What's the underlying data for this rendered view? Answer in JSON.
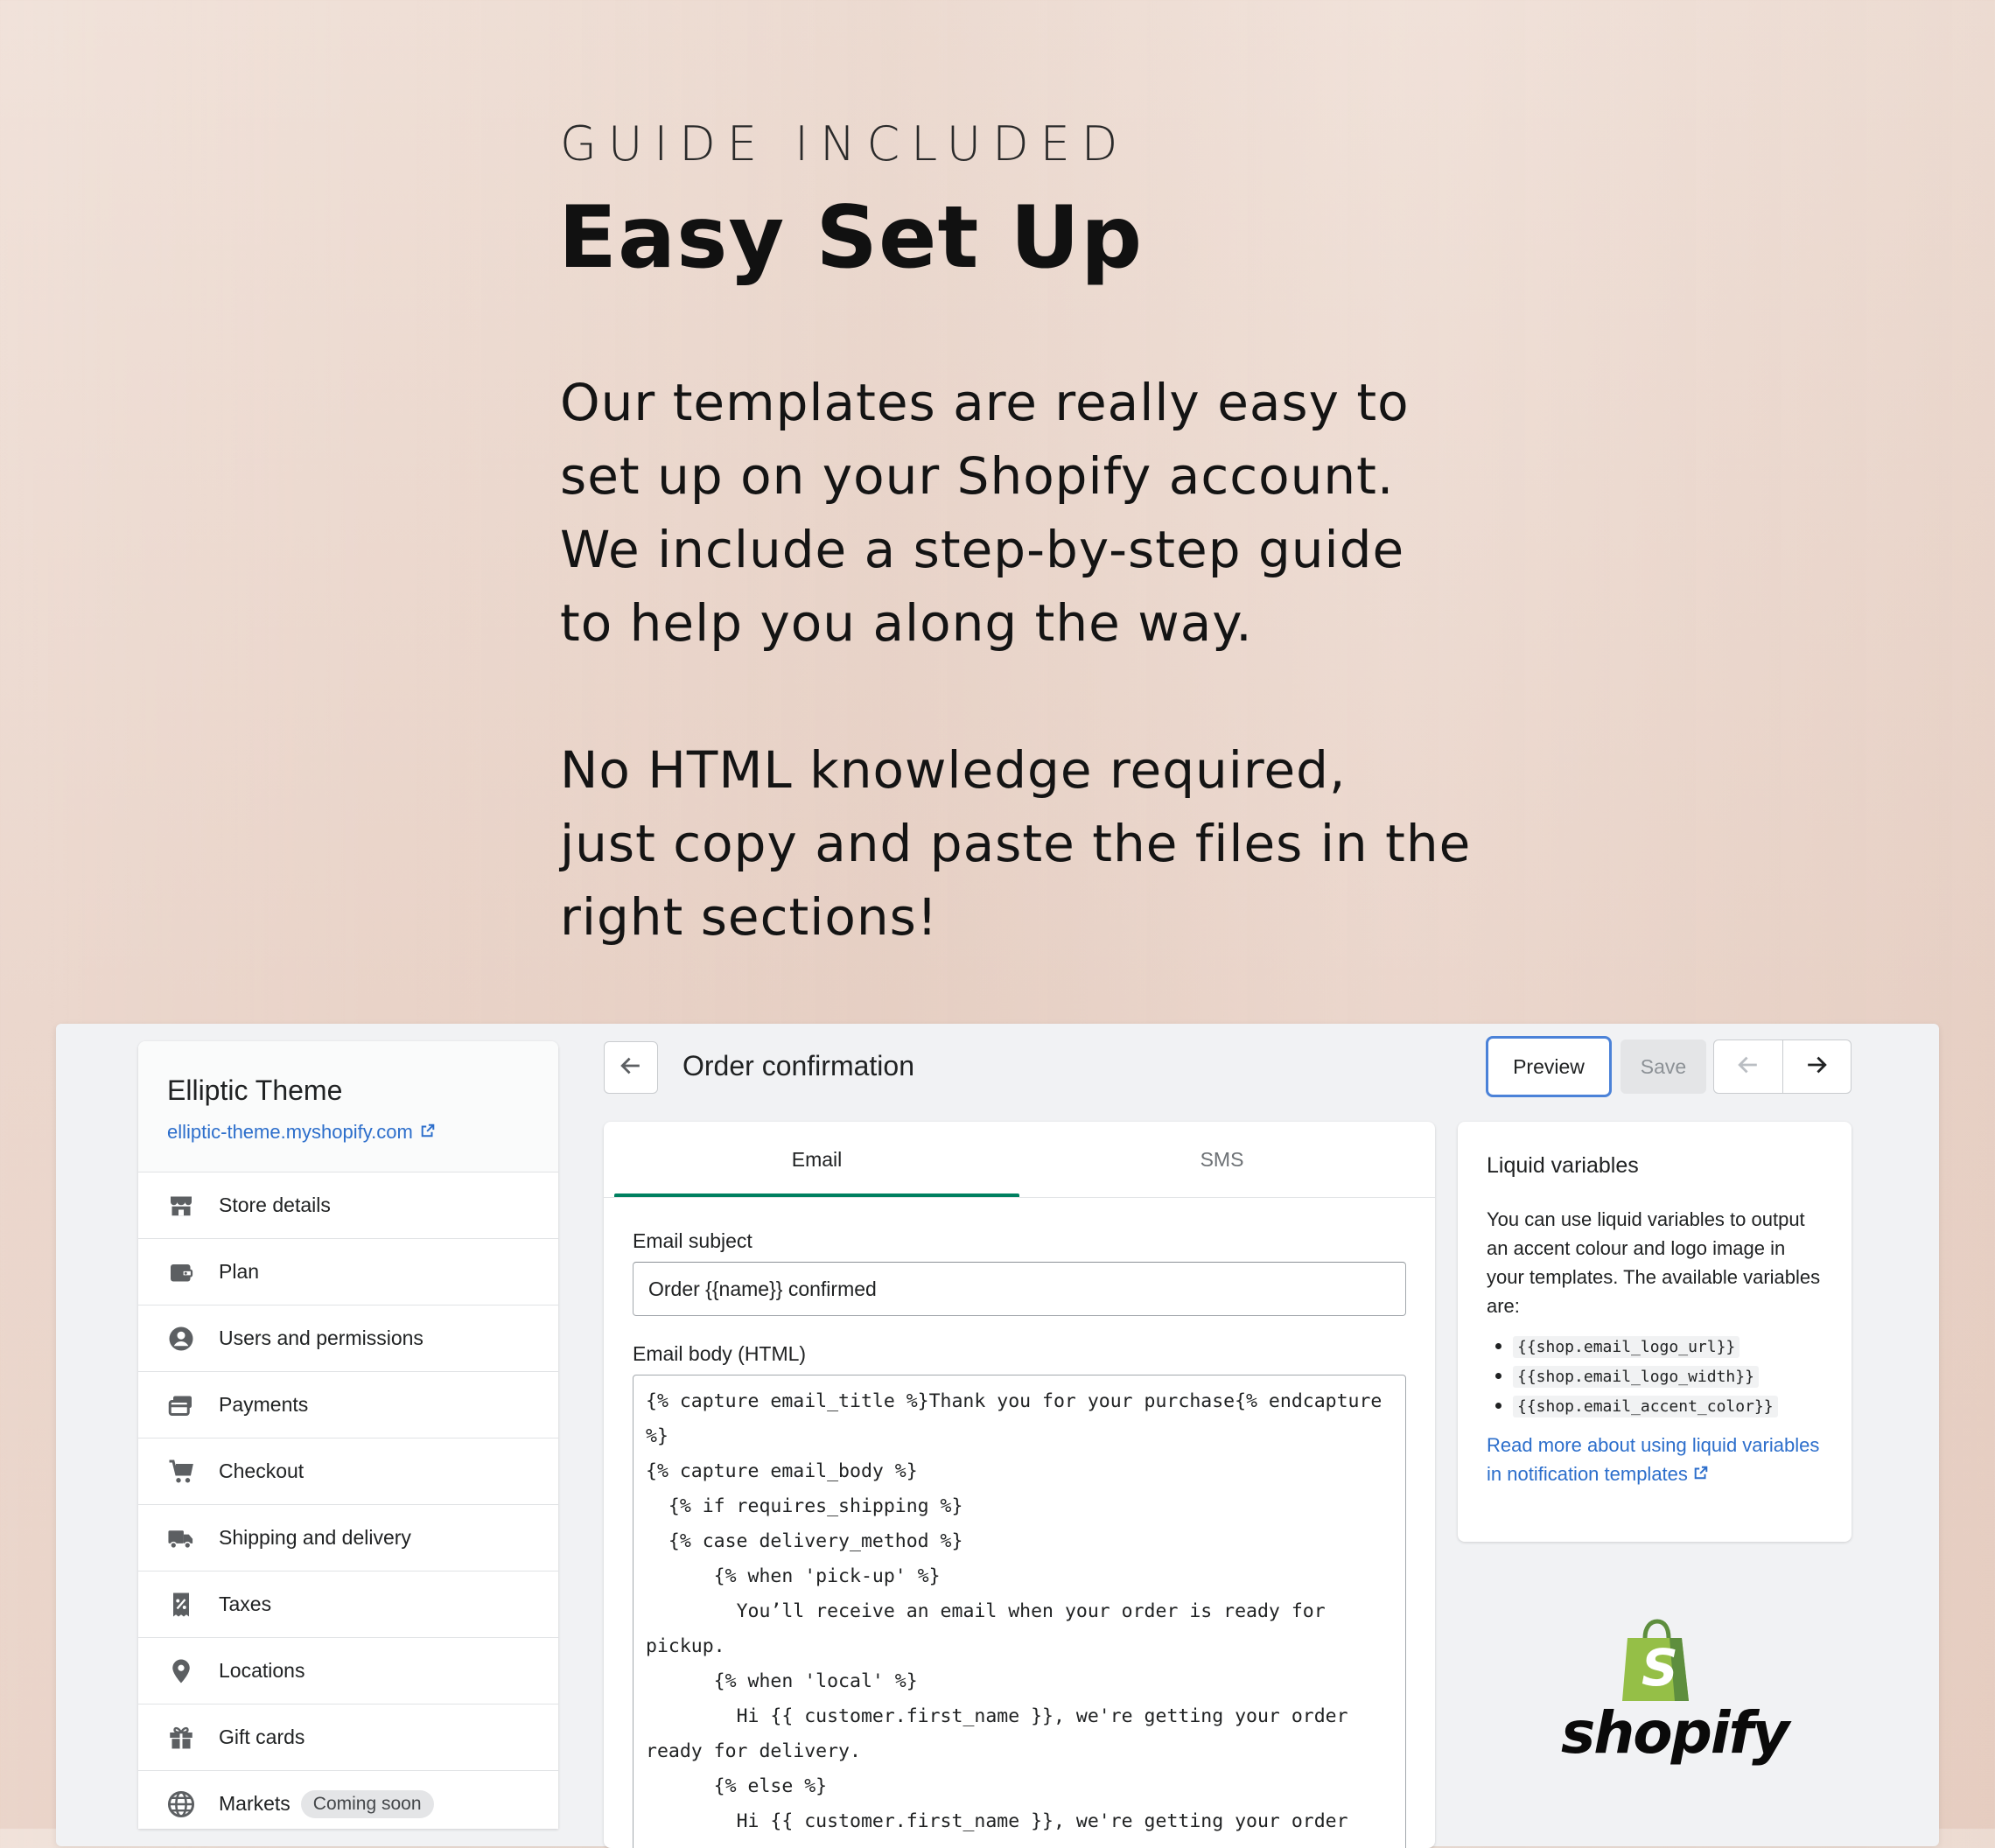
{
  "hero": {
    "eyebrow": "GUIDE INCLUDED",
    "headline": "Easy Set Up",
    "paragraph1_lines": [
      "Our templates are really easy to",
      "set up on your Shopify account.",
      "We include a step-by-step guide",
      "to help you along the way."
    ],
    "paragraph2_lines": [
      "No HTML knowledge required,",
      "just copy and paste the files in the",
      "right sections!"
    ]
  },
  "sidebar": {
    "store_name": "Elliptic Theme",
    "store_url": "elliptic-theme.myshopify.com",
    "items": [
      {
        "label": "Store details",
        "icon": "store-icon"
      },
      {
        "label": "Plan",
        "icon": "wallet-icon"
      },
      {
        "label": "Users and permissions",
        "icon": "user-circle-icon"
      },
      {
        "label": "Payments",
        "icon": "payment-card-icon"
      },
      {
        "label": "Checkout",
        "icon": "cart-icon"
      },
      {
        "label": "Shipping and delivery",
        "icon": "truck-icon"
      },
      {
        "label": "Taxes",
        "icon": "tax-receipt-icon"
      },
      {
        "label": "Locations",
        "icon": "location-pin-icon"
      },
      {
        "label": "Gift cards",
        "icon": "gift-icon"
      },
      {
        "label": "Markets",
        "icon": "globe-icon",
        "badge": "Coming soon"
      }
    ]
  },
  "header": {
    "title": "Order confirmation",
    "preview_label": "Preview",
    "save_label": "Save"
  },
  "tabs": [
    {
      "label": "Email",
      "active": true
    },
    {
      "label": "SMS",
      "active": false
    }
  ],
  "form": {
    "subject_label": "Email subject",
    "subject_value": "Order {{name}} confirmed",
    "body_label": "Email body (HTML)",
    "body_value": "{% capture email_title %}Thank you for your purchase{% endcapture %}\n{% capture email_body %}\n  {% if requires_shipping %}\n  {% case delivery_method %}\n      {% when 'pick-up' %}\n        You’ll receive an email when your order is ready for pickup.\n      {% when 'local' %}\n        Hi {{ customer.first_name }}, we're getting your order ready for delivery.\n      {% else %}\n        Hi {{ customer.first_name }}, we're getting your order"
  },
  "liquid": {
    "title": "Liquid variables",
    "description": "You can use liquid variables to output an accent colour and logo image in your templates. The available variables are:",
    "variables": [
      "{{shop.email_logo_url}}",
      "{{shop.email_logo_width}}",
      "{{shop.email_accent_color}}"
    ],
    "link_text": "Read more about using liquid variables in notification templates"
  },
  "logo": {
    "wordmark": "shopify",
    "bag_letter": "S"
  },
  "colors": {
    "accent_green": "#008060",
    "link_blue": "#2c6ecb",
    "shopify_green": "#95bf47"
  }
}
